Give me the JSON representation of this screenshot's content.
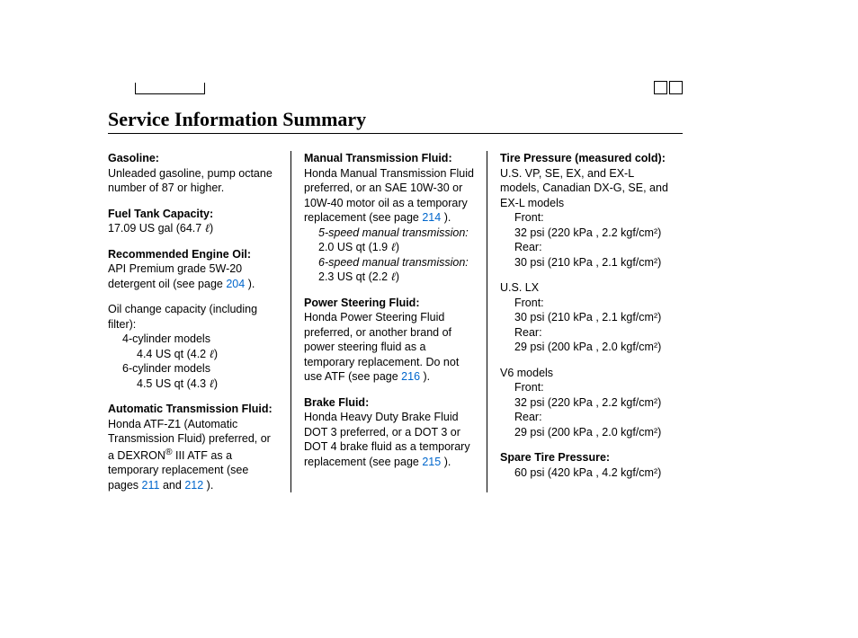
{
  "title": "Service Information Summary",
  "col1": {
    "gasoline": {
      "head": "Gasoline:",
      "body": "Unleaded gasoline, pump octane number of 87 or higher."
    },
    "fueltank": {
      "head": "Fuel Tank Capacity:",
      "val": "17.09 US gal (64.7 ",
      "unit": "ℓ",
      "close": ")"
    },
    "engoil": {
      "head": "Recommended Engine Oil:",
      "line1_a": "API Premium grade 5W-20 detergent oil (see page",
      "page1": "204",
      "line1_b": ")."
    },
    "oilchange": {
      "intro": "Oil change capacity (including filter):",
      "l1": "4-cylinder models",
      "l1v_a": "4.4 US qt (4.2 ",
      "l1v_u": "ℓ",
      "l1v_b": ")",
      "l2": "6-cylinder models",
      "l2v_a": "4.5 US qt (4.3 ",
      "l2v_u": "ℓ",
      "l2v_b": ")"
    },
    "atf": {
      "head": "Automatic Transmission Fluid:",
      "body_a": "Honda ATF-Z1 (Automatic Transmission Fluid) preferred, or a DEXRON",
      "reg": "®",
      "body_b": " III ATF as a temporary replacement (see pages",
      "page1": "211",
      "mid": "and",
      "page2": "212",
      "body_c": ")."
    }
  },
  "col2": {
    "mtf": {
      "head": "Manual Transmission Fluid:",
      "body_a": "Honda Manual Transmission Fluid preferred, or an SAE 10W-30 or 10W-40 motor oil as a temporary replacement (see page",
      "page1": "214",
      "body_b": ").",
      "sub1": "5-speed manual transmission:",
      "sub1v_a": "2.0 US qt (1.9 ",
      "sub1v_u": "ℓ",
      "sub1v_b": ")",
      "sub2": "6-speed manual transmission:",
      "sub2v_a": "2.3 US qt (2.2 ",
      "sub2v_u": "ℓ",
      "sub2v_b": ")"
    },
    "psf": {
      "head": "Power Steering Fluid:",
      "body_a": "Honda Power Steering Fluid preferred, or another brand of power steering fluid as a temporary replacement. Do not use ATF (see page",
      "page1": "216",
      "body_b": ")."
    },
    "brake": {
      "head": "Brake Fluid:",
      "body_a": "Honda Heavy Duty Brake Fluid DOT 3 preferred, or a DOT 3 or DOT 4 brake fluid as a temporary replacement (see page",
      "page1": "215",
      "body_b": ")."
    }
  },
  "col3": {
    "tire": {
      "head": "Tire Pressure (measured cold):",
      "grp1_name": "U.S. VP, SE, EX, and EX-L models, Canadian DX-G, SE, and EX-L models",
      "front_lbl": "Front:",
      "grp1_front": "32 psi (220 kPa , 2.2 kgf/cm²)",
      "rear_lbl": "Rear:",
      "grp1_rear": "30 psi (210 kPa , 2.1 kgf/cm²)",
      "grp2_name": "U.S. LX",
      "grp2_front": "30 psi (210 kPa , 2.1 kgf/cm²)",
      "grp2_rear": "29 psi (200 kPa , 2.0 kgf/cm²)",
      "grp3_name": "V6 models",
      "grp3_front": "32 psi (220 kPa , 2.2 kgf/cm²)",
      "grp3_rear": "29 psi (200 kPa , 2.0 kgf/cm²)"
    },
    "spare": {
      "head": "Spare Tire Pressure:",
      "val": "60 psi (420 kPa , 4.2 kgf/cm²)"
    }
  }
}
